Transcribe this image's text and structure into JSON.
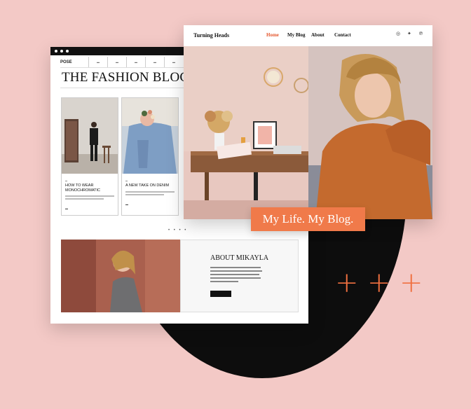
{
  "colors": {
    "background": "#f3c9c6",
    "accent": "#f07a4a",
    "dark": "#0d0d0d"
  },
  "fashion_blog": {
    "brand": "POSE",
    "title": "THE FASHION BLOG",
    "cards": [
      {
        "title": "HOW TO WEAR MONOCHROMATIC"
      },
      {
        "title": "A NEW TAKE ON DENIM"
      }
    ],
    "pager": "• • • •",
    "about_title": "ABOUT MIKAYLA"
  },
  "turning_heads": {
    "brand": "Turning Heads",
    "nav": [
      {
        "label": "Home",
        "active": true
      },
      {
        "label": "My Blog",
        "active": false
      },
      {
        "label": "About",
        "active": false
      },
      {
        "label": "Contact",
        "active": false
      }
    ],
    "social_icons": [
      "instagram-icon",
      "twitter-icon",
      "pinterest-icon"
    ],
    "tagline": "My Life. My Blog."
  },
  "decor": {
    "plus_signs": [
      "+",
      "+",
      "+"
    ]
  }
}
